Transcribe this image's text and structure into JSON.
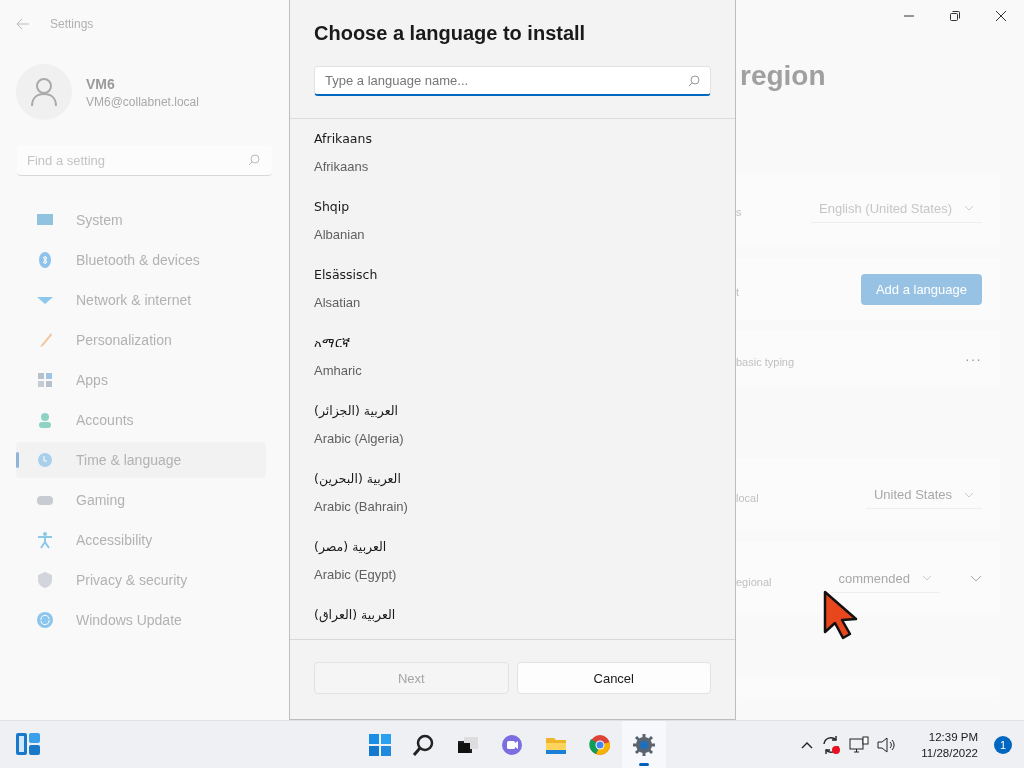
{
  "settings_window": {
    "title": "Settings",
    "user": {
      "name": "VM6",
      "email": "VM6@collabnet.local"
    },
    "search": {
      "placeholder": "Find a setting"
    },
    "nav_items": [
      {
        "label": "System",
        "selected": false
      },
      {
        "label": "Bluetooth & devices",
        "selected": false
      },
      {
        "label": "Network & internet",
        "selected": false
      },
      {
        "label": "Personalization",
        "selected": false
      },
      {
        "label": "Apps",
        "selected": false
      },
      {
        "label": "Accounts",
        "selected": false
      },
      {
        "label": "Time & language",
        "selected": true
      },
      {
        "label": "Gaming",
        "selected": false
      },
      {
        "label": "Accessibility",
        "selected": false
      },
      {
        "label": "Privacy & security",
        "selected": false
      },
      {
        "label": "Windows Update",
        "selected": false
      }
    ],
    "page_title": "region",
    "rows": [
      {
        "kind": "dropdown",
        "label": "s",
        "value": "English (United States)"
      },
      {
        "kind": "button",
        "label": "t",
        "value": "Add a language"
      },
      {
        "kind": "more",
        "label": "basic typing",
        "value": "···"
      },
      {
        "kind": "dropdown",
        "label": "local",
        "value": "United States"
      },
      {
        "kind": "dropdown_expand",
        "label": "egional",
        "value": "commended"
      }
    ]
  },
  "dialog": {
    "title": "Choose a language to install",
    "search": {
      "placeholder": "Type a language name..."
    },
    "languages": [
      {
        "native": "Afrikaans",
        "english": "Afrikaans"
      },
      {
        "native": "Shqip",
        "english": "Albanian"
      },
      {
        "native": "Elsässisch",
        "english": "Alsatian"
      },
      {
        "native": "አማርኛ",
        "english": "Amharic"
      },
      {
        "native": "العربية (الجزائر)",
        "english": "Arabic (Algeria)"
      },
      {
        "native": "العربية (البحرين)",
        "english": "Arabic (Bahrain)"
      },
      {
        "native": "العربية (مصر)",
        "english": "Arabic (Egypt)"
      },
      {
        "native": "العربية (العراق)"
      }
    ],
    "buttons": [
      {
        "label": "Next",
        "disabled": true
      },
      {
        "label": "Cancel",
        "disabled": false
      }
    ]
  },
  "taskbar": {
    "apps": [
      {
        "selected": false
      },
      {
        "selected": false
      },
      {
        "selected": false
      },
      {
        "selected": false
      },
      {
        "selected": false
      },
      {
        "selected": false
      },
      {
        "selected": true
      }
    ],
    "time": "12:39 PM",
    "date": "11/28/2022",
    "notifications": "1"
  }
}
